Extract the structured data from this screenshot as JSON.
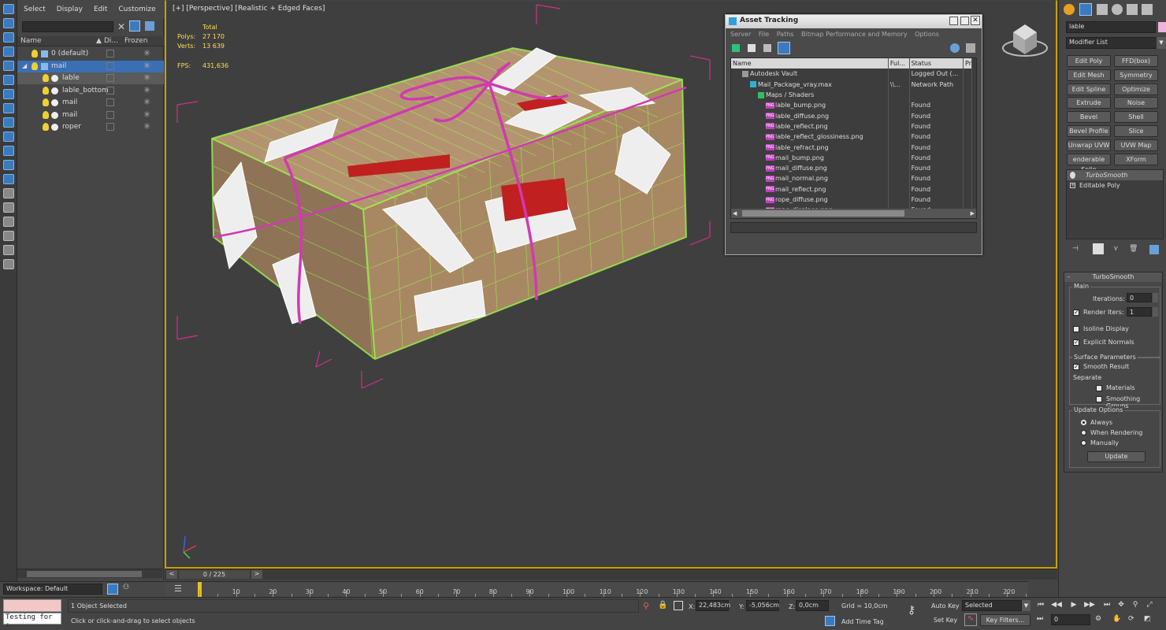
{
  "menu": [
    "Select",
    "Display",
    "Edit",
    "Customize"
  ],
  "explorer": {
    "columns": [
      "Name",
      "Di...",
      "Frozen"
    ],
    "rows": [
      {
        "name": "0 (default)",
        "indent": 0,
        "type": "layer"
      },
      {
        "name": "mail",
        "indent": 0,
        "type": "layer",
        "selected": true
      },
      {
        "name": "lable",
        "indent": 1,
        "type": "object",
        "highlight": true
      },
      {
        "name": "lable_bottom",
        "indent": 1,
        "type": "object"
      },
      {
        "name": "mail",
        "indent": 1,
        "type": "object"
      },
      {
        "name": "mail",
        "indent": 1,
        "type": "object"
      },
      {
        "name": "roper",
        "indent": 1,
        "type": "object"
      }
    ],
    "workspace": "Workspace: Default"
  },
  "viewport": {
    "label": "[+] [Perspective] [Realistic + Edged Faces]",
    "stats": {
      "total": "Total",
      "polys_label": "Polys:",
      "polys": "27 170",
      "verts_label": "Verts:",
      "verts": "13 639",
      "fps_label": "FPS:",
      "fps": "431,636"
    }
  },
  "asset_tracking": {
    "title": "Asset Tracking",
    "menu": [
      "Server",
      "File",
      "Paths",
      "Bitmap Performance and Memory",
      "Options"
    ],
    "columns": [
      "Name",
      "Ful...",
      "Status",
      "Pr"
    ],
    "rows": [
      {
        "name": "Autodesk Vault",
        "full": "",
        "status": "Logged Out (...",
        "indent": 1,
        "icon": "vault"
      },
      {
        "name": "Mail_Package_vray.max",
        "full": "\\\\...",
        "status": "Network Path",
        "indent": 2,
        "icon": "max"
      },
      {
        "name": "Maps / Shaders",
        "full": "",
        "status": "",
        "indent": 3,
        "icon": "maps"
      },
      {
        "name": "lable_bump.png",
        "full": "",
        "status": "Found",
        "indent": 4,
        "icon": "png"
      },
      {
        "name": "lable_diffuse.png",
        "full": "",
        "status": "Found",
        "indent": 4,
        "icon": "png"
      },
      {
        "name": "lable_reflect.png",
        "full": "",
        "status": "Found",
        "indent": 4,
        "icon": "png"
      },
      {
        "name": "lable_reflect_glossiness.png",
        "full": "",
        "status": "Found",
        "indent": 4,
        "icon": "png"
      },
      {
        "name": "lable_refract.png",
        "full": "",
        "status": "Found",
        "indent": 4,
        "icon": "png"
      },
      {
        "name": "mail_bump.png",
        "full": "",
        "status": "Found",
        "indent": 4,
        "icon": "png"
      },
      {
        "name": "mail_diffuse.png",
        "full": "",
        "status": "Found",
        "indent": 4,
        "icon": "png"
      },
      {
        "name": "mail_normal.png",
        "full": "",
        "status": "Found",
        "indent": 4,
        "icon": "png"
      },
      {
        "name": "mail_reflect.png",
        "full": "",
        "status": "Found",
        "indent": 4,
        "icon": "png"
      },
      {
        "name": "rope_diffuse.png",
        "full": "",
        "status": "Found",
        "indent": 4,
        "icon": "png"
      },
      {
        "name": "rope_displace.png",
        "full": "",
        "status": "Found",
        "indent": 4,
        "icon": "png"
      }
    ]
  },
  "command_panel": {
    "object_name": "lable",
    "modifier_list": "Modifier List",
    "modifier_buttons": [
      "Edit Poly",
      "FFD(box)",
      "Edit Mesh",
      "Symmetry",
      "Edit Spline",
      "Optimize",
      "Extrude",
      "Noise",
      "Bevel",
      "Shell",
      "Bevel Profile",
      "Slice",
      "Unwrap UVW",
      "UVW Map",
      "enderable Splin",
      "XForm"
    ],
    "stack": [
      "TurboSmooth",
      "Editable Poly"
    ],
    "turbosmooth": {
      "title": "TurboSmooth",
      "main": "Main",
      "iterations_label": "Iterations:",
      "iterations": "0",
      "render_iters_label": "Render Iters:",
      "render_iters": "1",
      "isoline": "Isoline Display",
      "explicit": "Explicit Normals",
      "surface": "Surface Parameters",
      "smooth_result": "Smooth Result",
      "separate": "Separate",
      "materials": "Materials",
      "smoothing_groups": "Smoothing Groups",
      "update_options": "Update Options",
      "always": "Always",
      "when_rendering": "When Rendering",
      "manually": "Manually",
      "update": "Update"
    }
  },
  "timeline": {
    "frame": "0 / 225",
    "ticks": [
      "10",
      "20",
      "30",
      "40",
      "50",
      "60",
      "70",
      "80",
      "90",
      "100",
      "110",
      "120",
      "130",
      "140",
      "150",
      "160",
      "170",
      "180",
      "190",
      "200",
      "210",
      "220"
    ]
  },
  "status": {
    "script": "Testing for :",
    "selected": "1 Object Selected",
    "prompt": "Click or click-and-drag to select objects",
    "x_label": "X:",
    "x": "22,483cm",
    "y_label": "Y:",
    "y": "-5,056cm",
    "z_label": "Z:",
    "z": "0,0cm",
    "grid": "Grid = 10,0cm",
    "add_time_tag": "Add Time Tag",
    "auto_key": "Auto Key",
    "selected_set": "Selected",
    "set_key": "Set Key",
    "key_filters": "Key Filters...",
    "frame_field": "0"
  }
}
